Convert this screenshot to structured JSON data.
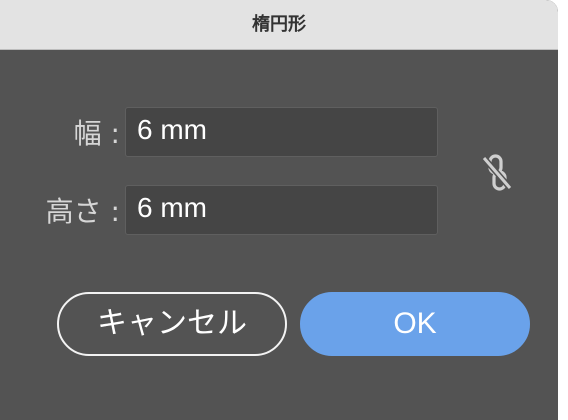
{
  "dialog": {
    "title": "楕円形"
  },
  "fields": {
    "width": {
      "label": "幅 :",
      "value": "6 mm"
    },
    "height": {
      "label": "高さ :",
      "value": "6 mm"
    }
  },
  "link": {
    "icon": "unlink-chain-icon",
    "state": "unlinked"
  },
  "buttons": {
    "cancel_label": "キャンセル",
    "ok_label": "OK"
  },
  "colors": {
    "dialog_bg": "#535353",
    "titlebar_bg": "#e3e3e3",
    "field_bg": "#454545",
    "primary_button": "#6aa2ea"
  }
}
